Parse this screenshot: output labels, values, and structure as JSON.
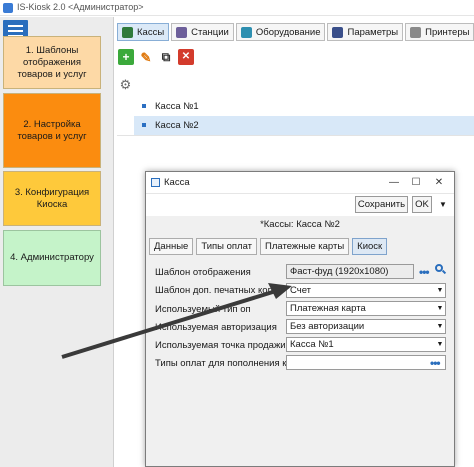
{
  "window": {
    "title": "IS-Kiosk 2.0 <Администратор>"
  },
  "sidebar": {
    "menu_icon": "hamburger-menu-icon",
    "items": [
      {
        "label": "1. Шаблоны отображения товаров и услуг",
        "color": "#fdd9a6"
      },
      {
        "label": "2. Настройка товаров и услуг",
        "color": "#fb8c0f"
      },
      {
        "label": "3. Конфигурация Киоска",
        "color": "#fec93b"
      },
      {
        "label": "4. Администратору",
        "color": "#c5f3c9"
      }
    ]
  },
  "tabs": [
    {
      "label": "Кассы",
      "icon": "cash-register-icon",
      "active": true
    },
    {
      "label": "Станции",
      "icon": "station-icon",
      "active": false
    },
    {
      "label": "Оборудование",
      "icon": "hardware-icon",
      "active": false
    },
    {
      "label": "Параметры",
      "icon": "settings-icon",
      "active": false
    },
    {
      "label": "Принтеры",
      "icon": "printer-icon",
      "active": false
    }
  ],
  "toolbar": {
    "add_icon": "plus-icon",
    "edit_icon": "pencil-icon",
    "copy_icon": "copy-icon",
    "delete_icon": "delete-icon"
  },
  "list": {
    "settings_icon": "gear-icon",
    "rows": [
      {
        "label": "Касса №1",
        "selected": false
      },
      {
        "label": "Касса №2",
        "selected": true
      }
    ]
  },
  "dialog": {
    "title": "Касса",
    "save_label": "Сохранить",
    "ok_label": "OK",
    "heading": "*Кассы:  Касса №2",
    "tabs": [
      {
        "label": "Данные",
        "active": false
      },
      {
        "label": "Типы оплат",
        "active": false
      },
      {
        "label": "Платежные карты",
        "active": false
      },
      {
        "label": "Киоск",
        "active": true
      }
    ],
    "fields": [
      {
        "label": "Шаблон отображения",
        "value": "Фаст-фуд (1920x1080)"
      },
      {
        "label": "Шаблон доп. печатных копий",
        "value": "Счет"
      },
      {
        "label": "Используемый тип оп",
        "value": "Платежная карта"
      },
      {
        "label": "Используемая авторизация",
        "value": "Без авторизации"
      },
      {
        "label": "Используемая точка продажи",
        "value": "Касса №1"
      },
      {
        "label": "Типы оплат для пополнения карт",
        "value": ""
      }
    ]
  },
  "annotation": {
    "arrow_color": "#3a3a3a"
  }
}
